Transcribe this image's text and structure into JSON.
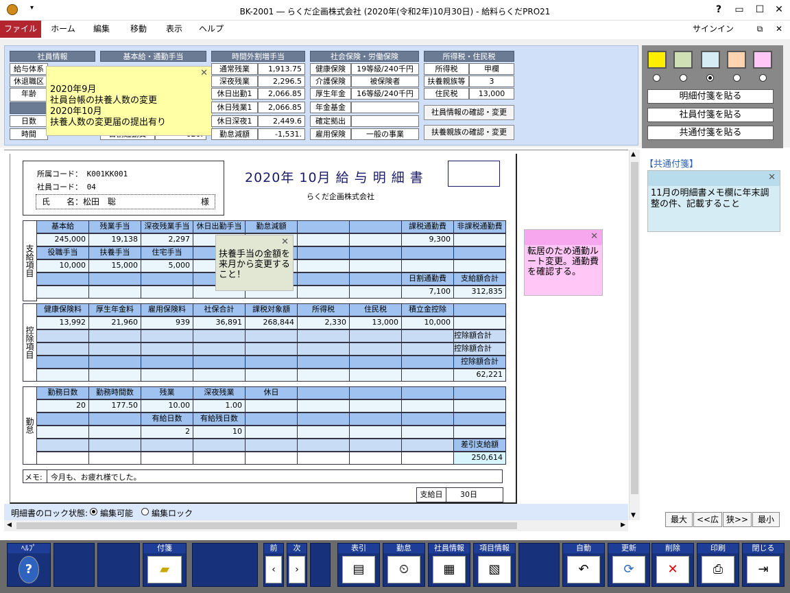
{
  "window": {
    "title": "BK-2001 ― らくだ企画株式会社 (2020年(令和2年)10月30日) - 給料らくだPRO21",
    "help": "?",
    "signin": "サインイン"
  },
  "menu": [
    "ファイル",
    "ホーム",
    "編集",
    "移動",
    "表示",
    "ヘルプ"
  ],
  "info": {
    "employee": {
      "header": "社員情報",
      "rows": [
        "給与体系",
        "休退職区",
        "年齢",
        "日数",
        "時間"
      ]
    },
    "base": {
      "header": "基本給・通勤手当",
      "partial": [
        "勤勿",
        "日割通勤費",
        "620."
      ]
    },
    "overtime": {
      "header": "時間外割増手当",
      "rows": [
        [
          "通常残業",
          "1,913.75"
        ],
        [
          "深夜残業",
          "2,296.5"
        ],
        [
          "休日出勤1",
          "2,066.85"
        ],
        [
          "休日残業1",
          "2,066.85"
        ],
        [
          "休日深夜1",
          "2,449.6"
        ],
        [
          "勤怠減額",
          "-1,531."
        ]
      ]
    },
    "insurance": {
      "header": "社会保険・労働保険",
      "rows": [
        [
          "健康保険",
          "19等級/240千円"
        ],
        [
          "介護保険",
          "被保険者"
        ],
        [
          "厚生年金",
          "16等級/240千円"
        ],
        [
          "年金基金",
          ""
        ],
        [
          "確定拠出",
          ""
        ],
        [
          "雇用保険",
          "一般の事業"
        ]
      ]
    },
    "tax": {
      "header": "所得税・住民税",
      "rows": [
        [
          "所得税",
          "甲欄"
        ],
        [
          "扶養親族等",
          "3"
        ],
        [
          "住民税",
          "13,000"
        ]
      ],
      "btn1": "社員情報の確認・変更",
      "btn2": "扶養親族の確認・変更"
    }
  },
  "side": {
    "btn1": "明細付箋を貼る",
    "btn2": "社員付箋を貼る",
    "btn3": "共通付箋を貼る",
    "common_label": "【共通付箋】",
    "common_note": "11月の明細書メモ欄に年末調整の件、記載すること",
    "zoom": [
      "最大",
      "<<広",
      "狭>>",
      "最小"
    ],
    "colors": [
      "#ffee00",
      "#cfe0b4",
      "#d6ecf5",
      "#ffd3b0",
      "#ffc6f6"
    ]
  },
  "notes": {
    "yellow": [
      "2020年9月",
      "社員台帳の扶養人数の変更",
      "2020年10月",
      "扶養人数の変更届の提出有り"
    ],
    "green": "扶養手当の金額を来月から変更すること！",
    "pink": "転居のため通勤ルート変更。通勤費を確認する。"
  },
  "slip": {
    "dept_label": "所属コード：",
    "dept": "K001KK001",
    "emp_label": "社員コード：",
    "emp": "04",
    "name_label": "氏　　名：",
    "name": "松田　聡",
    "sama": "様",
    "title": "2020年 10月 給 与 明 細 書",
    "company": "らくだ企画株式会社",
    "pay_label": "支給項目",
    "pay_h1": [
      "基本給",
      "残業手当",
      "深夜残業手当",
      "休日出勤手当",
      "勤怠減額",
      "",
      "",
      "課税通勤費",
      "非課税通勤費"
    ],
    "pay_v1": [
      "245,000",
      "19,138",
      "2,297",
      "",
      "",
      "",
      "",
      "9,300",
      ""
    ],
    "pay_h2": [
      "役職手当",
      "扶養手当",
      "住宅手当",
      "",
      "",
      "",
      "",
      "",
      ""
    ],
    "pay_v2": [
      "10,000",
      "15,000",
      "5,000",
      "",
      "",
      "",
      "",
      "",
      ""
    ],
    "pay_h3": [
      "",
      "",
      "",
      "",
      "",
      "",
      "",
      "日割通勤費",
      "支給額合計"
    ],
    "pay_v3": [
      "",
      "",
      "",
      "",
      "",
      "",
      "",
      "7,100",
      "312,835"
    ],
    "ded_label": "控除項目",
    "ded_h1": [
      "健康保険料",
      "厚生年金料",
      "雇用保険料",
      "社保合計",
      "課税対象額",
      "所得税",
      "住民税",
      "積立金控除",
      ""
    ],
    "ded_v1": [
      "13,992",
      "21,960",
      "939",
      "36,891",
      "268,844",
      "2,330",
      "13,000",
      "10,000",
      ""
    ],
    "ded_h3": [
      "",
      "",
      "",
      "",
      "",
      "",
      "",
      "",
      "控除額合計"
    ],
    "ded_v3": [
      "",
      "",
      "",
      "",
      "",
      "",
      "",
      "",
      "62,221"
    ],
    "att_label": "勤怠",
    "att_h1": [
      "勤務日数",
      "勤務時間数",
      "残業",
      "深夜残業",
      "休日",
      "",
      "",
      "",
      ""
    ],
    "att_v1": [
      "20",
      "177.50",
      "10.00",
      "1.00",
      "",
      "",
      "",
      "",
      ""
    ],
    "att_h2": [
      "",
      "",
      "有給日数",
      "有給残日数",
      "",
      "",
      "",
      "",
      ""
    ],
    "att_v2": [
      "",
      "",
      "2",
      "10",
      "",
      "",
      "",
      "",
      ""
    ],
    "net_label": "差引支給額",
    "net": "250,614",
    "memo_label": "メモ:",
    "memo": "今月も、お疲れ様でした。",
    "payday_label": "支給日",
    "payday": "30日"
  },
  "lock": {
    "label": "明細書のロック状態:",
    "editable": "編集可能",
    "locked": "編集ロック"
  },
  "toolbar": {
    "help": "ﾍﾙﾌﾟ",
    "tag": "付箋",
    "prev": "前",
    "next": "次",
    "index": "表引",
    "attendance": "勤怠",
    "empinfo": "社員情報",
    "iteminfo": "項目情報",
    "auto": "自動",
    "update": "更新",
    "delete": "削除",
    "print": "印刷",
    "close": "閉じる"
  }
}
